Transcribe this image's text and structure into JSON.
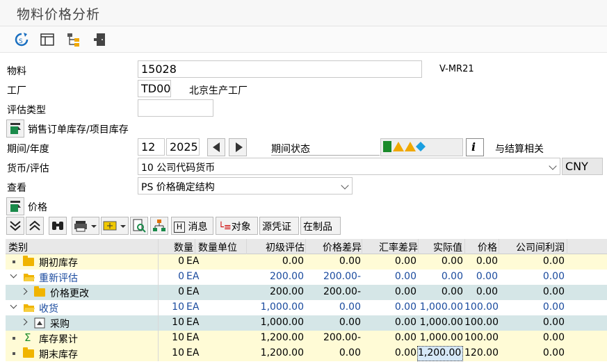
{
  "title": "物料价格分析",
  "transaction": "V-MR21",
  "fields": {
    "material_label": "物料",
    "material_value": "15028",
    "plant_label": "工厂",
    "plant_value": "TD00",
    "plant_desc": "北京生产工厂",
    "valtype_label": "评估类型",
    "valtype_value": "",
    "sales_order_button": "销售订单库存/项目库存",
    "period_label": "期间/年度",
    "period_value": "12",
    "year_value": "2025",
    "period_status_label": "期间状态",
    "settlement_label": "与结算相关",
    "currency_label": "货币/评估",
    "currency_value": "10 公司代码货币",
    "currency_code": "CNY",
    "view_label": "查看",
    "view_value": "PS 价格确定结构",
    "price_button": "价格"
  },
  "grid_toolbar": {
    "message": "消息",
    "object": "对象",
    "source": "源凭证",
    "wip": "在制品"
  },
  "columns": [
    "类别",
    "数量",
    "数量单位",
    "初级评估",
    "价格差异",
    "汇率差异",
    "实际值",
    "价格",
    "公司间利润"
  ],
  "rows": [
    {
      "cat": "期初库存",
      "qty": "0",
      "unit": "EA",
      "prim": "0.00",
      "pdiff": "0.00",
      "xdiff": "0.00",
      "actual": "0.00",
      "price": "0.00",
      "ico": "0.00",
      "style": "yellow",
      "icon": "folder",
      "lead": "bullet",
      "indent": 0,
      "blue": false
    },
    {
      "cat": "重新评估",
      "qty": "0",
      "unit": "EA",
      "prim": "200.00",
      "pdiff": "200.00-",
      "xdiff": "0.00",
      "actual": "0.00",
      "price": "0.00",
      "ico": "0.00",
      "style": "white",
      "icon": "open-folder",
      "lead": "expanded",
      "indent": 0,
      "blue": true
    },
    {
      "cat": "价格更改",
      "qty": "0",
      "unit": "EA",
      "prim": "200.00",
      "pdiff": "200.00-",
      "xdiff": "0.00",
      "actual": "0.00",
      "price": "0.00",
      "ico": "0.00",
      "style": "teal",
      "icon": "folder",
      "lead": "collapsed",
      "indent": 1,
      "blue": false
    },
    {
      "cat": "收货",
      "qty": "10",
      "unit": "EA",
      "prim": "1,000.00",
      "pdiff": "0.00",
      "xdiff": "0.00",
      "actual": "1,000.00",
      "price": "100.00",
      "ico": "0.00",
      "style": "white",
      "icon": "open-folder",
      "lead": "expanded",
      "indent": 0,
      "blue": true
    },
    {
      "cat": "采购",
      "qty": "10",
      "unit": "EA",
      "prim": "1,000.00",
      "pdiff": "0.00",
      "xdiff": "0.00",
      "actual": "1,000.00",
      "price": "100.00",
      "ico": "0.00",
      "style": "teal",
      "icon": "procurement",
      "lead": "collapsed",
      "indent": 1,
      "blue": false
    },
    {
      "cat": "库存累计",
      "qty": "10",
      "unit": "EA",
      "prim": "1,200.00",
      "pdiff": "200.00-",
      "xdiff": "0.00",
      "actual": "1,000.00",
      "price": "100.00",
      "ico": "0.00",
      "style": "yellow",
      "icon": "sigma",
      "lead": "bullet",
      "indent": 0,
      "blue": false
    },
    {
      "cat": "期末库存",
      "qty": "10",
      "unit": "EA",
      "prim": "1,200.00",
      "pdiff": "0.00",
      "xdiff": "0.00",
      "actual": "1,200.00",
      "price": "120.00",
      "ico": "0.00",
      "style": "yellow",
      "icon": "folder",
      "lead": "bullet",
      "indent": 0,
      "blue": false
    }
  ],
  "colors": {
    "yellow_row": "#fffbd6",
    "teal_row": "#d5e6e7",
    "blue_text": "#1a4a9e",
    "header_bg": "#e8e8e8",
    "status_green": "#1a8a2a",
    "status_yellow": "#f0a800",
    "status_blue": "#1a9fe0"
  }
}
